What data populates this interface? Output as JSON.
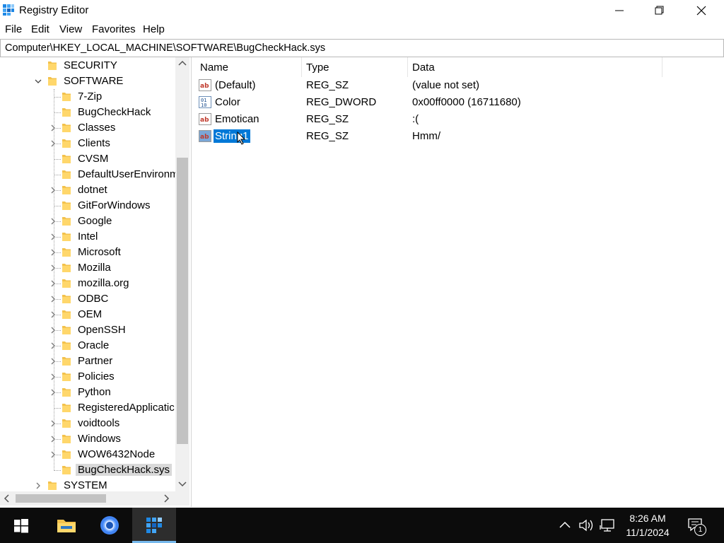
{
  "window": {
    "title": "Registry Editor",
    "icons": {
      "app": "registry-editor-icon",
      "minimize": "minimize-icon",
      "maximize": "restore-icon",
      "close": "close-icon"
    }
  },
  "menu": {
    "items": [
      "File",
      "Edit",
      "View",
      "Favorites",
      "Help"
    ]
  },
  "address": {
    "path": "Computer\\HKEY_LOCAL_MACHINE\\SOFTWARE\\BugCheckHack.sys"
  },
  "tree": {
    "items": [
      {
        "label": "SECURITY",
        "expander": "none"
      },
      {
        "label": "SOFTWARE",
        "expander": "expanded"
      },
      {
        "label": "7-Zip",
        "expander": "none"
      },
      {
        "label": "BugCheckHack",
        "expander": "none"
      },
      {
        "label": "Classes",
        "expander": "collapsed"
      },
      {
        "label": "Clients",
        "expander": "collapsed"
      },
      {
        "label": "CVSM",
        "expander": "none"
      },
      {
        "label": "DefaultUserEnvironm",
        "expander": "none"
      },
      {
        "label": "dotnet",
        "expander": "collapsed"
      },
      {
        "label": "GitForWindows",
        "expander": "none"
      },
      {
        "label": "Google",
        "expander": "collapsed"
      },
      {
        "label": "Intel",
        "expander": "collapsed"
      },
      {
        "label": "Microsoft",
        "expander": "collapsed"
      },
      {
        "label": "Mozilla",
        "expander": "collapsed"
      },
      {
        "label": "mozilla.org",
        "expander": "collapsed"
      },
      {
        "label": "ODBC",
        "expander": "collapsed"
      },
      {
        "label": "OEM",
        "expander": "collapsed"
      },
      {
        "label": "OpenSSH",
        "expander": "collapsed"
      },
      {
        "label": "Oracle",
        "expander": "collapsed"
      },
      {
        "label": "Partner",
        "expander": "collapsed"
      },
      {
        "label": "Policies",
        "expander": "collapsed"
      },
      {
        "label": "Python",
        "expander": "collapsed"
      },
      {
        "label": "RegisteredApplicatic",
        "expander": "none"
      },
      {
        "label": "voidtools",
        "expander": "collapsed"
      },
      {
        "label": "Windows",
        "expander": "collapsed"
      },
      {
        "label": "WOW6432Node",
        "expander": "collapsed"
      },
      {
        "label": "BugCheckHack.sys",
        "expander": "none",
        "selected": true
      },
      {
        "label": "SYSTEM",
        "expander": "collapsed"
      }
    ]
  },
  "values": {
    "columns": [
      "Name",
      "Type",
      "Data"
    ],
    "rows": [
      {
        "name": "(Default)",
        "type": "REG_SZ",
        "data": "(value not set)",
        "icon": "string-value-icon"
      },
      {
        "name": "Color",
        "type": "REG_DWORD",
        "data": "0x00ff0000 (16711680)",
        "icon": "binary-value-icon"
      },
      {
        "name": "Emotican",
        "type": "REG_SZ",
        "data": ":(",
        "icon": "string-value-icon"
      },
      {
        "name": "String1",
        "type": "REG_SZ",
        "data": "Hmm/",
        "icon": "string-value-icon",
        "selected": true
      }
    ]
  },
  "taskbar": {
    "apps": [
      "start-icon",
      "file-explorer-icon",
      "chrome-icon",
      "registry-editor-icon"
    ],
    "active_app": "registry-editor-icon",
    "time": "8:26 AM",
    "date": "11/1/2024",
    "notification_count": "1"
  },
  "colors": {
    "selection": "#0078d7",
    "folder": "#f3c24d",
    "taskbar": "#0c0c0c"
  }
}
